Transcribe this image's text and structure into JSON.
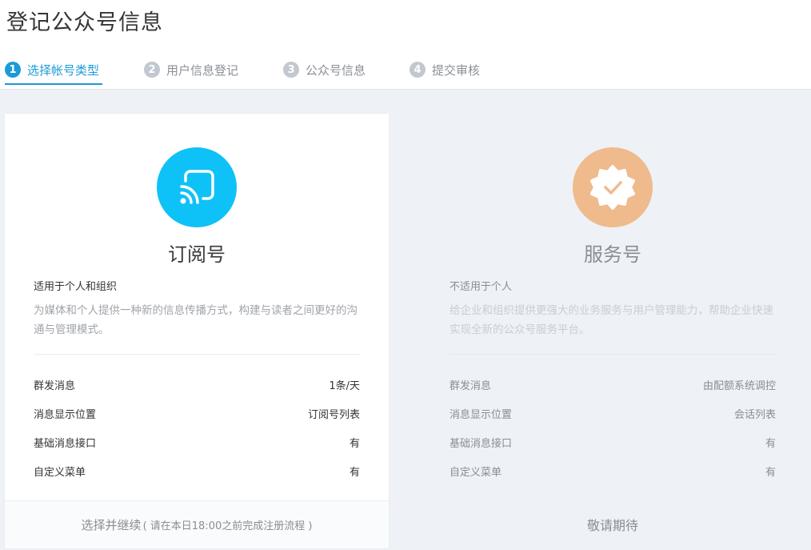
{
  "page": {
    "title": "登记公众号信息"
  },
  "steps": [
    {
      "num": "1",
      "label": "选择帐号类型",
      "active": true
    },
    {
      "num": "2",
      "label": "用户信息登记",
      "active": false
    },
    {
      "num": "3",
      "label": "公众号信息",
      "active": false
    },
    {
      "num": "4",
      "label": "提交审核",
      "active": false
    }
  ],
  "subscription": {
    "name": "订阅号",
    "applies_to": "适用于个人和组织",
    "description": "为媒体和个人提供一种新的信息传播方式，构建与读者之间更好的沟通与管理模式。",
    "icon": "rss-icon",
    "color": "#0ec2f7",
    "features": [
      {
        "label": "群发消息",
        "value": "1条/天"
      },
      {
        "label": "消息显示位置",
        "value": "订阅号列表"
      },
      {
        "label": "基础消息接口",
        "value": "有"
      },
      {
        "label": "自定义菜单",
        "value": "有"
      }
    ],
    "action": "选择并继续",
    "action_hint": "( 请在本日18:00之前完成注册流程 )"
  },
  "service": {
    "name": "服务号",
    "applies_to": "不适用于个人",
    "description": "给企业和组织提供更强大的业务服务与用户管理能力，帮助企业快速实现全新的公众号服务平台。",
    "icon": "verified-badge-icon",
    "color": "#efba8c",
    "features": [
      {
        "label": "群发消息",
        "value": "由配额系统调控"
      },
      {
        "label": "消息显示位置",
        "value": "会话列表"
      },
      {
        "label": "基础消息接口",
        "value": "有"
      },
      {
        "label": "自定义菜单",
        "value": "有"
      }
    ],
    "action": "敬请期待"
  },
  "colors": {
    "accent": "#1d9bd8",
    "inactive_step": "#c3c7cf"
  }
}
